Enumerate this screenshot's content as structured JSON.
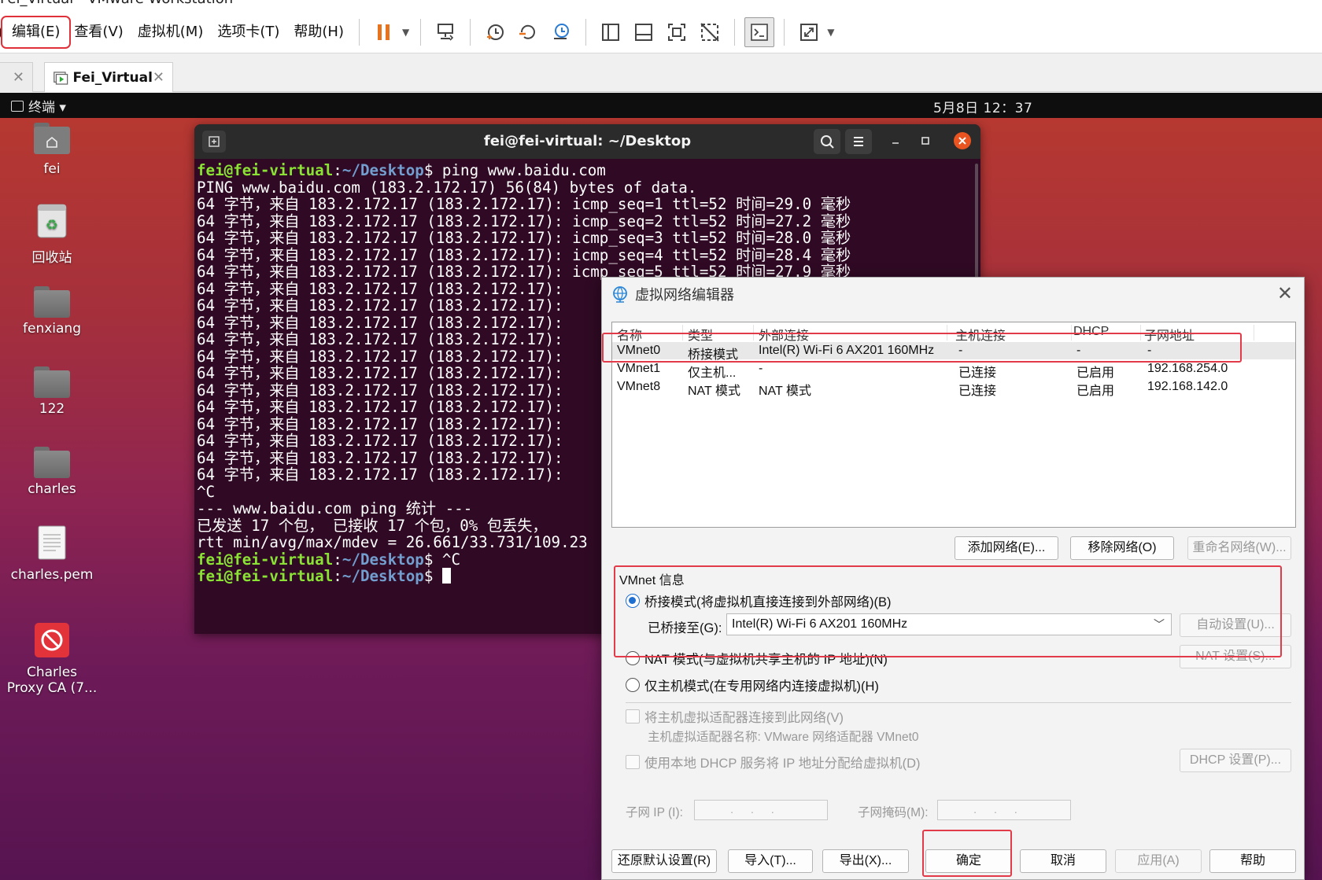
{
  "window": {
    "title": "Fei_Virtual - VMware Workstation"
  },
  "menu": {
    "stub": ")",
    "items": [
      "编辑(E)",
      "查看(V)",
      "虚拟机(M)",
      "选项卡(T)",
      "帮助(H)"
    ]
  },
  "tabs": {
    "home_close": "✕",
    "vm_label": "Fei_Virtual",
    "vm_close": "✕"
  },
  "guest": {
    "activities": "终端 ▾",
    "clock": "5月8日  12：37",
    "desktop_icons": [
      "fei",
      "回收站",
      "fenxiang",
      "122",
      "charles",
      "charles.pem",
      "Charles\nProxy CA (7..."
    ]
  },
  "terminal": {
    "title": "fei@fei-virtual: ~/Desktop",
    "prompt_user": "fei@fei-virtual",
    "prompt_path": "~/Desktop",
    "first_cmd": "$ ping www.baidu.com",
    "ping_header": "PING www.baidu.com (183.2.172.17) 56(84) bytes of data.",
    "reply_lines": [
      "64 字节，来自 183.2.172.17 (183.2.172.17): icmp_seq=1 ttl=52 时间=29.0 毫秒",
      "64 字节，来自 183.2.172.17 (183.2.172.17): icmp_seq=2 ttl=52 时间=27.2 毫秒",
      "64 字节，来自 183.2.172.17 (183.2.172.17): icmp_seq=3 ttl=52 时间=28.0 毫秒",
      "64 字节，来自 183.2.172.17 (183.2.172.17): icmp_seq=4 ttl=52 时间=28.4 毫秒",
      "64 字节，来自 183.2.172.17 (183.2.172.17): icmp_seq=5 ttl=52 时间=27.9 毫秒",
      "64 字节，来自 183.2.172.17 (183.2.172.17):",
      "64 字节，来自 183.2.172.17 (183.2.172.17):",
      "64 字节，来自 183.2.172.17 (183.2.172.17):",
      "64 字节，来自 183.2.172.17 (183.2.172.17):",
      "64 字节，来自 183.2.172.17 (183.2.172.17):",
      "64 字节，来自 183.2.172.17 (183.2.172.17):",
      "64 字节，来自 183.2.172.17 (183.2.172.17):",
      "64 字节，来自 183.2.172.17 (183.2.172.17):",
      "64 字节，来自 183.2.172.17 (183.2.172.17):",
      "64 字节，来自 183.2.172.17 (183.2.172.17):",
      "64 字节，来自 183.2.172.17 (183.2.172.17):",
      "64 字节，来自 183.2.172.17 (183.2.172.17):"
    ],
    "interrupt": "^C",
    "stats_header": "--- www.baidu.com ping 统计 ---",
    "stats_sent": "已发送 17 个包， 已接收 17 个包，0% 包丢失，",
    "rtt": "rtt min/avg/max/mdev = 26.661/33.731/109.23",
    "second_cmd": "$ ^C",
    "last_prompt_suffix": "$ "
  },
  "dialog": {
    "title": "虚拟网络编辑器",
    "close": "✕",
    "columns": [
      "名称",
      "类型",
      "外部连接",
      "主机连接",
      "DHCP",
      "子网地址"
    ],
    "rows": [
      [
        "VMnet0",
        "桥接模式",
        "Intel(R) Wi-Fi 6 AX201 160MHz",
        "-",
        "-",
        "-"
      ],
      [
        "VMnet1",
        "仅主机...",
        "-",
        "已连接",
        "已启用",
        "192.168.254.0"
      ],
      [
        "VMnet8",
        "NAT 模式",
        "NAT 模式",
        "已连接",
        "已启用",
        "192.168.142.0"
      ]
    ],
    "add_network": "添加网络(E)...",
    "remove_network": "移除网络(O)",
    "rename_network": "重命名网络(W)...",
    "group_title": "VMnet 信息",
    "bridge_radio": "桥接模式(将虚拟机直接连接到外部网络)(B)",
    "bridged_to_label": "已桥接至(G):",
    "bridged_to_value": "Intel(R) Wi-Fi 6 AX201 160MHz",
    "auto_settings": "自动设置(U)...",
    "nat_radio": "NAT 模式(与虚拟机共享主机的 IP 地址)(N)",
    "nat_settings": "NAT 设置(S)...",
    "hostonly_radio": "仅主机模式(在专用网络内连接虚拟机)(H)",
    "connect_adapter": "将主机虚拟适配器连接到此网络(V)",
    "adapter_name": "主机虚拟适配器名称: VMware 网络适配器 VMnet0",
    "use_dhcp": "使用本地 DHCP 服务将 IP 地址分配给虚拟机(D)",
    "dhcp_settings": "DHCP 设置(P)...",
    "subnet_ip_label": "子网 IP (I):",
    "subnet_mask_label": "子网掩码(M):",
    "ip_placeholder": "...",
    "restore_defaults": "还原默认设置(R)",
    "import": "导入(T)...",
    "export": "导出(X)...",
    "ok": "确定",
    "cancel": "取消",
    "apply": "应用(A)",
    "help": "帮助"
  }
}
